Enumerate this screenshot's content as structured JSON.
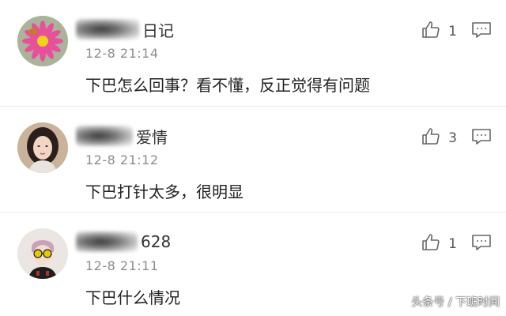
{
  "comments": [
    {
      "name_suffix": "日记",
      "time": "12-8 21:14",
      "content": "下巴怎么回事？看不懂，反正觉得有问题",
      "likes": "1",
      "avatar_icon": "flower-avatar-icon"
    },
    {
      "name_suffix": "爱情",
      "time": "12-8 21:12",
      "content": "下巴打针太多，很明显",
      "likes": "3",
      "avatar_icon": "woman-avatar-icon"
    },
    {
      "name_suffix": "628",
      "time": "12-8 21:11",
      "content": "下巴什么情况",
      "likes": "1",
      "avatar_icon": "sunglasses-avatar-icon"
    }
  ],
  "watermark": "头条号 / 下班时间",
  "icons": {
    "like": "thumbs-up-icon",
    "reply": "comment-icon"
  },
  "colors": {
    "text": "#222222",
    "time": "#8d8d8d",
    "icon": "#666666"
  }
}
